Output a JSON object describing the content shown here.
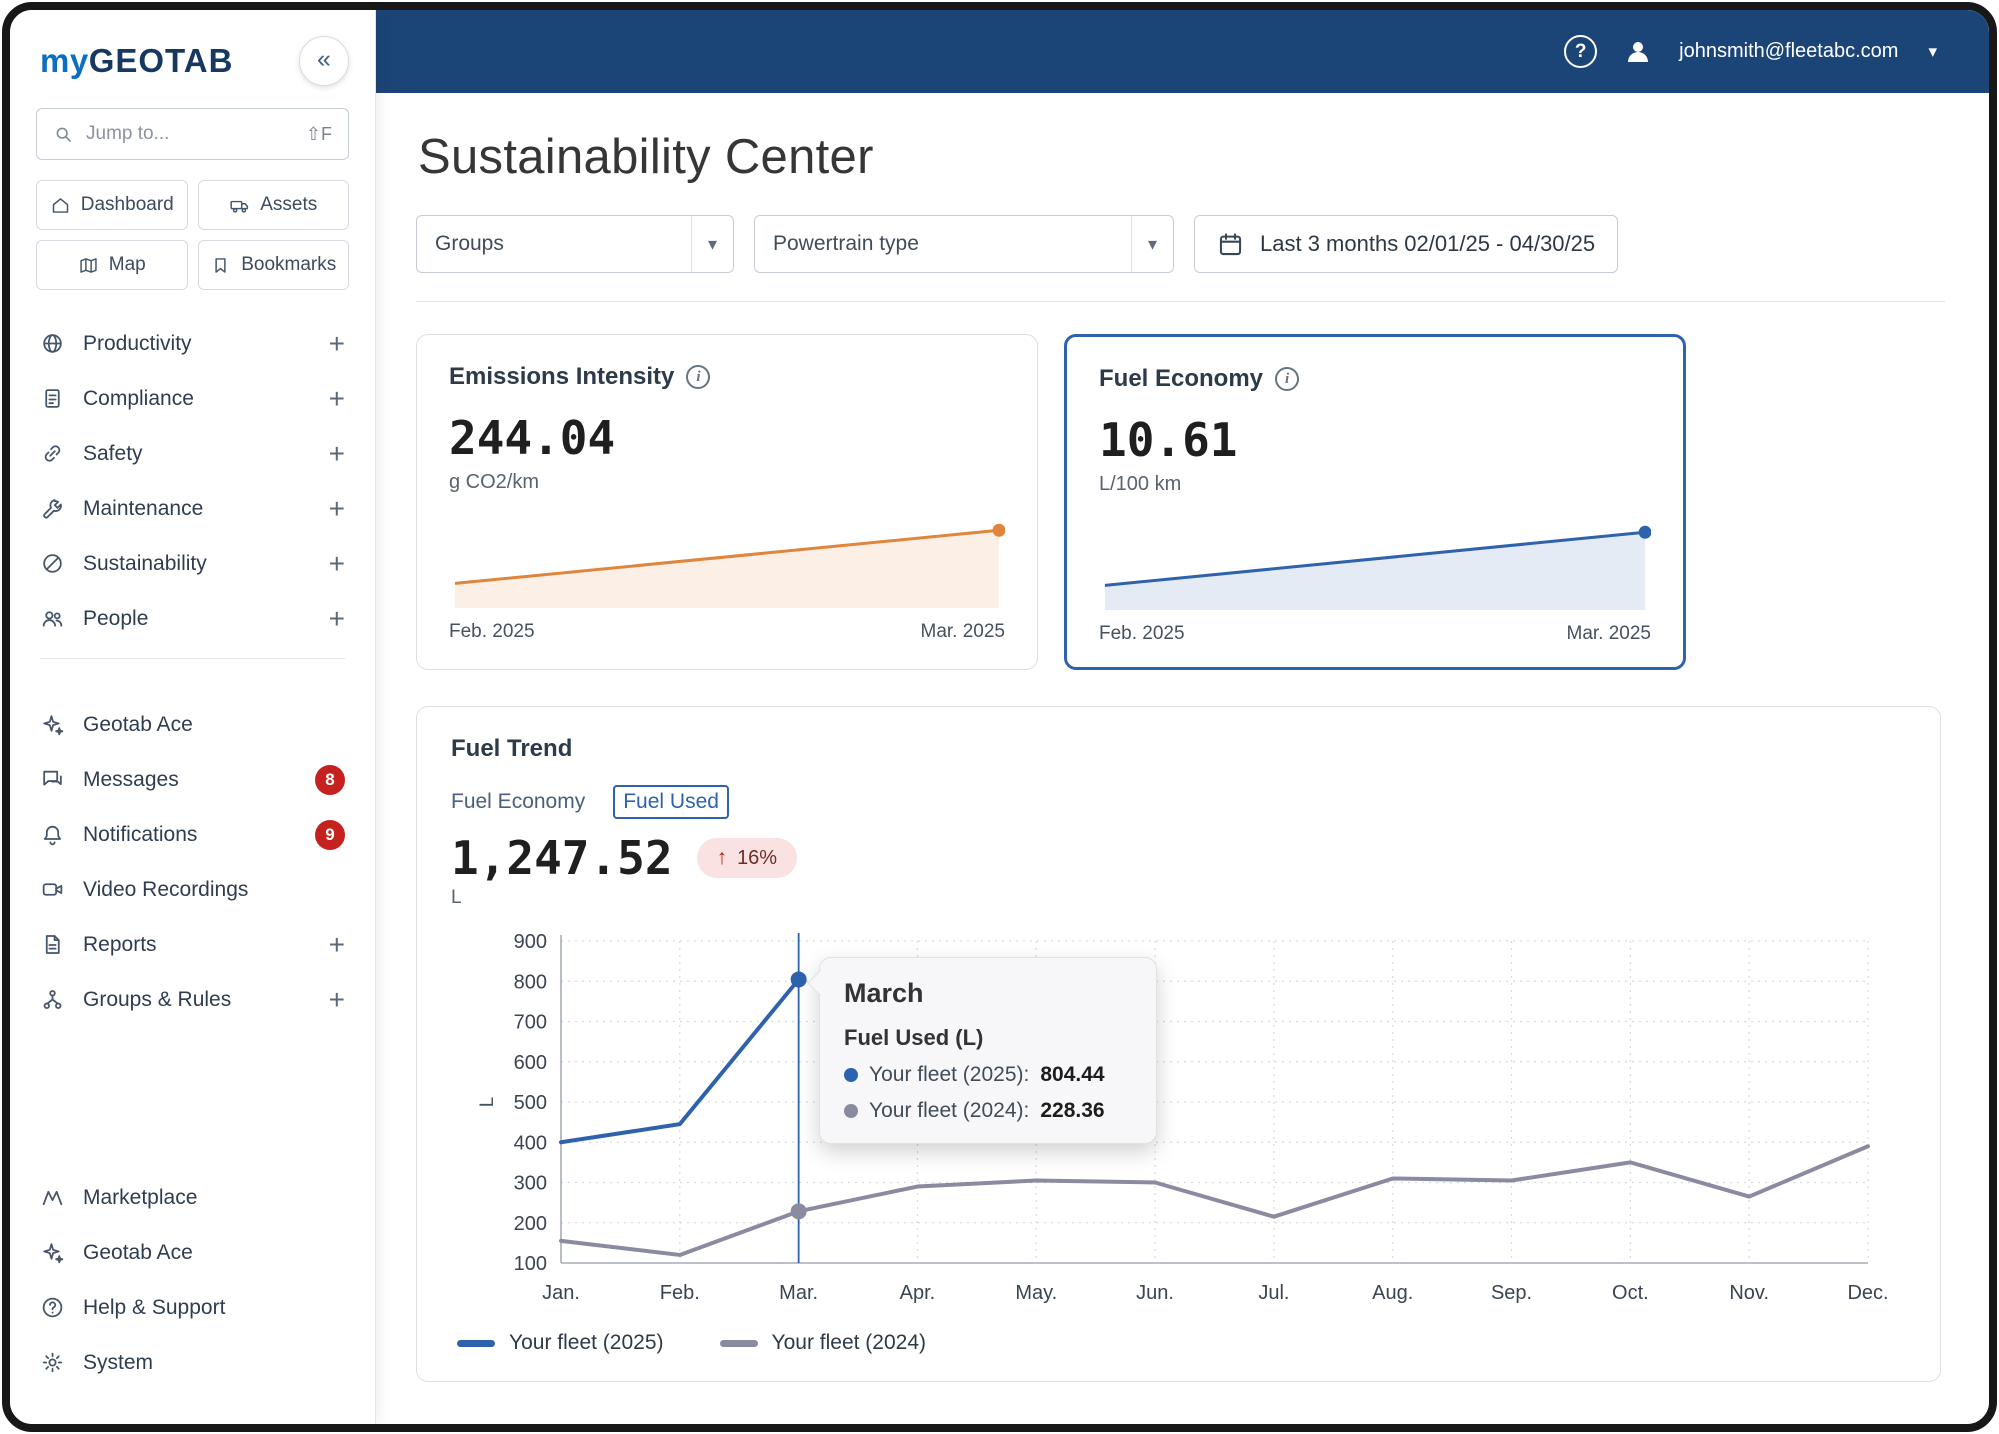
{
  "brand": {
    "my": "my",
    "geotab": "GEOTAB"
  },
  "icons": {
    "collapse": "«",
    "caret_down": "▾",
    "plus": "+",
    "help": "?",
    "info": "i",
    "up_arrow": "↑"
  },
  "topbar": {
    "email": "johnsmith@fleetabc.com"
  },
  "sidebar": {
    "search": {
      "placeholder": "Jump to...",
      "shortcut": "⇧F"
    },
    "quick": [
      {
        "label": "Dashboard"
      },
      {
        "label": "Assets"
      },
      {
        "label": "Map"
      },
      {
        "label": "Bookmarks"
      }
    ],
    "nav": [
      {
        "label": "Productivity"
      },
      {
        "label": "Compliance"
      },
      {
        "label": "Safety"
      },
      {
        "label": "Maintenance"
      },
      {
        "label": "Sustainability"
      },
      {
        "label": "People"
      }
    ],
    "tools": [
      {
        "label": "Geotab Ace"
      },
      {
        "label": "Messages",
        "badge": "8"
      },
      {
        "label": "Notifications",
        "badge": "9"
      },
      {
        "label": "Video Recordings"
      },
      {
        "label": "Reports"
      },
      {
        "label": "Groups & Rules"
      }
    ],
    "footer": [
      {
        "label": "Marketplace"
      },
      {
        "label": "Geotab Ace"
      },
      {
        "label": "Help & Support"
      },
      {
        "label": "System"
      }
    ]
  },
  "page": {
    "title": "Sustainability Center"
  },
  "filters": {
    "groups": "Groups",
    "powertrain": "Powertrain type",
    "date_range": "Last 3 months 02/01/25 - 04/30/25"
  },
  "kpis": {
    "emissions": {
      "title": "Emissions Intensity",
      "value": "244.04",
      "unit": "g CO2/km",
      "x_start": "Feb. 2025",
      "x_end": "Mar. 2025"
    },
    "fuel_economy": {
      "title": "Fuel Economy",
      "value": "10.61",
      "unit": "L/100 km",
      "x_start": "Feb. 2025",
      "x_end": "Mar. 2025"
    }
  },
  "fuel_trend": {
    "title": "Fuel Trend",
    "tab_economy": "Fuel Economy",
    "tab_used": "Fuel Used",
    "value": "1,247.52",
    "unit": "L",
    "change": "16%",
    "tooltip": {
      "title": "March",
      "subtitle": "Fuel Used (L)",
      "rows": [
        {
          "label": "Your fleet (2025):",
          "value": "804.44"
        },
        {
          "label": "Your fleet (2024):",
          "value": "228.36"
        }
      ]
    },
    "legend": [
      {
        "label": "Your fleet (2025)"
      },
      {
        "label": "Your fleet (2024)"
      }
    ]
  },
  "chart_data": [
    {
      "name": "emissions_intensity_spark",
      "type": "area",
      "x": [
        "Feb. 2025",
        "Mar. 2025"
      ],
      "values": [
        206,
        244.04
      ],
      "title": "Emissions Intensity",
      "ylabel": "g CO2/km",
      "color": "#e0853c"
    },
    {
      "name": "fuel_economy_spark",
      "type": "area",
      "x": [
        "Feb. 2025",
        "Mar. 2025"
      ],
      "values": [
        9.1,
        10.61
      ],
      "title": "Fuel Economy",
      "ylabel": "L/100 km",
      "color": "#2e62ad"
    },
    {
      "name": "fuel_trend",
      "type": "line",
      "title": "Fuel Trend — Fuel Used",
      "ylabel": "L",
      "ylim": [
        100,
        900
      ],
      "yticks": [
        100,
        200,
        300,
        400,
        500,
        600,
        700,
        800,
        900
      ],
      "categories": [
        "Jan.",
        "Feb.",
        "Mar.",
        "Apr.",
        "May.",
        "Jun.",
        "Jul.",
        "Aug.",
        "Sep.",
        "Oct.",
        "Nov.",
        "Dec."
      ],
      "grid": true,
      "legend_position": "bottom",
      "highlight_index": 2,
      "series": [
        {
          "name": "Your fleet (2025)",
          "color": "#2e62ad",
          "values": [
            400,
            445,
            804.44
          ]
        },
        {
          "name": "Your fleet (2024)",
          "color": "#8a8aa0",
          "values": [
            155,
            120,
            228.36,
            290,
            305,
            300,
            215,
            310,
            305,
            350,
            265,
            390
          ]
        }
      ]
    }
  ]
}
